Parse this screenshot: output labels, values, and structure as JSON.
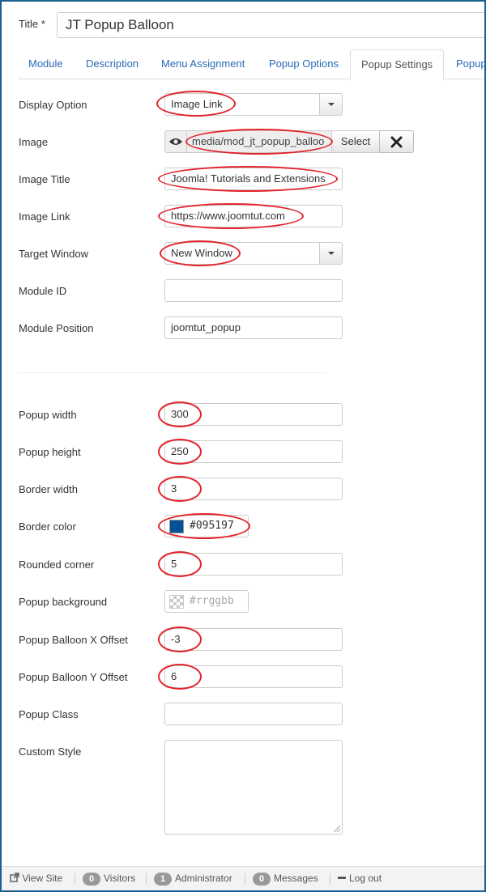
{
  "title": {
    "label": "Title *",
    "value": "JT Popup Balloon"
  },
  "tabs": [
    {
      "label": "Module"
    },
    {
      "label": "Description"
    },
    {
      "label": "Menu Assignment"
    },
    {
      "label": "Popup Options"
    },
    {
      "label": "Popup Settings",
      "active": true
    },
    {
      "label": "Popup"
    }
  ],
  "fields": {
    "display_option": {
      "label": "Display Option",
      "value": "Image Link"
    },
    "image": {
      "label": "Image",
      "path": "media/mod_jt_popup_balloo",
      "select_label": "Select",
      "clear_icon": "close-icon",
      "preview_icon": "eye-icon"
    },
    "image_title": {
      "label": "Image Title",
      "value": "Joomla! Tutorials and Extensions"
    },
    "image_link": {
      "label": "Image Link",
      "value": "https://www.joomtut.com"
    },
    "target_window": {
      "label": "Target Window",
      "value": "New Window"
    },
    "module_id": {
      "label": "Module ID",
      "value": ""
    },
    "module_position": {
      "label": "Module Position",
      "value": "joomtut_popup"
    },
    "popup_width": {
      "label": "Popup width",
      "value": "300"
    },
    "popup_height": {
      "label": "Popup height",
      "value": "250"
    },
    "border_width": {
      "label": "Border width",
      "value": "3"
    },
    "border_color": {
      "label": "Border color",
      "value": "#095197",
      "swatch": "#095197"
    },
    "rounded_corner": {
      "label": "Rounded corner",
      "value": "5"
    },
    "popup_background": {
      "label": "Popup background",
      "value": "#rrggbb"
    },
    "x_offset": {
      "label": "Popup Balloon X Offset",
      "value": "-3"
    },
    "y_offset": {
      "label": "Popup Balloon Y Offset",
      "value": "6"
    },
    "popup_class": {
      "label": "Popup Class",
      "value": ""
    },
    "custom_style": {
      "label": "Custom Style",
      "value": ""
    }
  },
  "statusbar": {
    "view_site": "View Site",
    "visitors": {
      "count": "0",
      "label": "Visitors"
    },
    "admins": {
      "count": "1",
      "label": "Administrator"
    },
    "messages": {
      "count": "0",
      "label": "Messages"
    },
    "logout": "Log out"
  },
  "colors": {
    "link": "#2a69b8",
    "annotation": "#e3232b",
    "frame": "#1c5f91"
  }
}
